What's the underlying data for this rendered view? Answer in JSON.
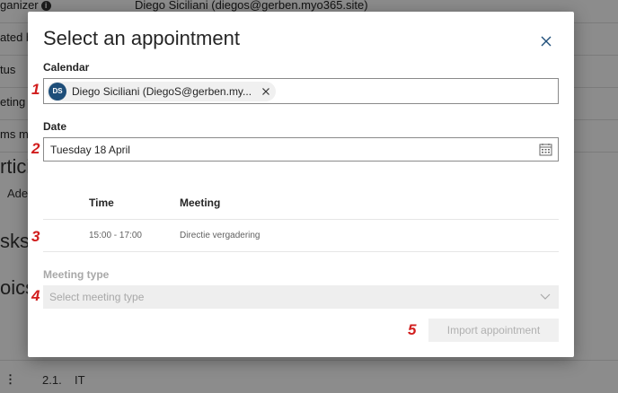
{
  "background": {
    "rows": [
      {
        "label": "ganizer",
        "value": "Diego Siciliani (diegos@gerben.myo365.site)",
        "info": "i"
      },
      {
        "label": "ated b",
        "value": ""
      },
      {
        "label": "tus",
        "value": ""
      },
      {
        "label": "eting",
        "value": ""
      },
      {
        "label": "ms m",
        "value": ""
      }
    ],
    "section_participants": "rtici",
    "participant": "Adel",
    "section_tasks": "sks",
    "section_topics": "oics",
    "topic_number": "2.1.",
    "topic_title": "IT",
    "menu_glyph": "⋮"
  },
  "modal": {
    "title": "Select an appointment",
    "close_icon": "close-icon",
    "calendar": {
      "label": "Calendar",
      "selected": {
        "initials": "DS",
        "name": "Diego Siciliani (DiegoS@gerben.my...",
        "avatar_color": "#1e4e79"
      }
    },
    "date": {
      "label": "Date",
      "value": "Tuesday 18 April",
      "icon": "calendar-icon"
    },
    "table": {
      "headers": [
        "Time",
        "Meeting"
      ],
      "rows": [
        {
          "time": "15:00 - 17:00",
          "meeting": "Directie vergadering"
        }
      ]
    },
    "meeting_type": {
      "label": "Meeting type",
      "placeholder": "Select meeting type"
    },
    "import_button": "Import appointment"
  },
  "steps": [
    "1",
    "2",
    "3",
    "4",
    "5"
  ],
  "colors": {
    "accent": "#1e4e79",
    "step_marker": "#d11d1d",
    "overlay": "rgba(0,0,0,0.45)"
  }
}
